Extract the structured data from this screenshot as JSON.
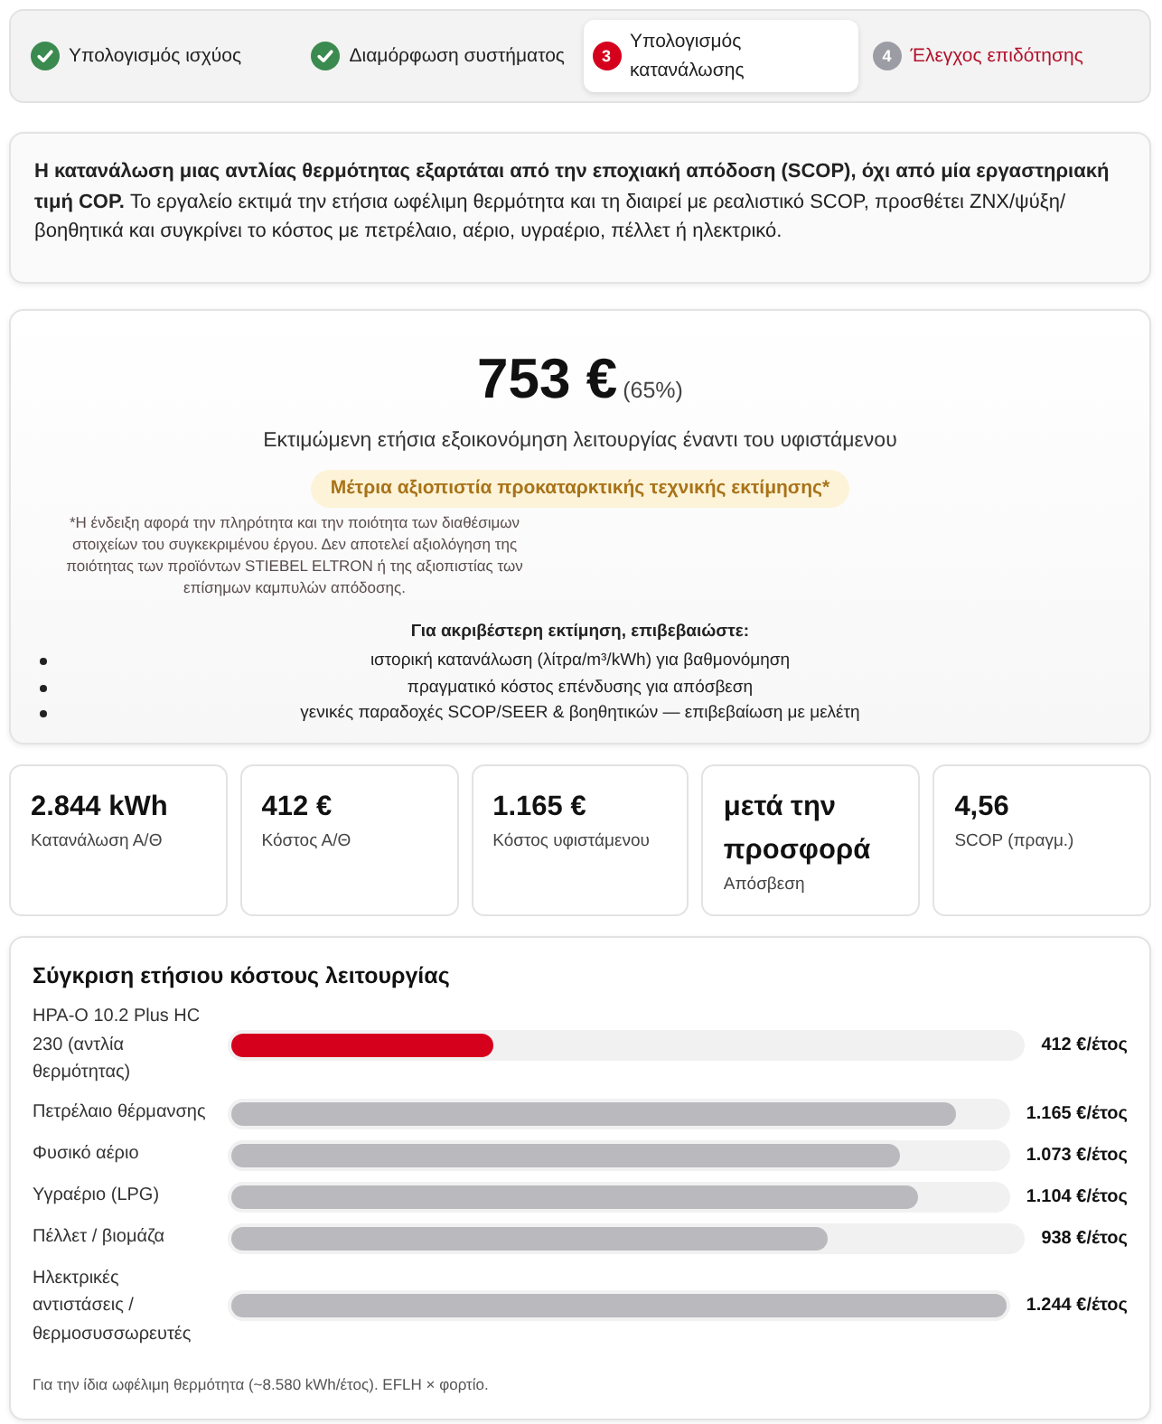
{
  "steps": [
    {
      "label": "Υπολογισμός ισχύος",
      "completed": true,
      "selected": false
    },
    {
      "label": "Διαμόρφωση συστήματος",
      "completed": true,
      "selected": false
    },
    {
      "label": "Υπολογισμός κατανάλωσης",
      "number": "3",
      "completed": false,
      "selected": true
    },
    {
      "label": "Έλεγχος επιδότησης",
      "number": "4",
      "completed": false,
      "selected": false
    }
  ],
  "intro": {
    "text": "**Η κατανάλωση μιας αντλίας θερμότητας εξαρτάται από την εποχιακή απόδοση (SCOP), όχι από μία εργαστηριακή τιμή COP.** Το εργαλείο εκτιμά την ετήσια ωφέλιμη θερμότητα και τη διαιρεί με ρεαλιστικό SCOP, προσθέτει ΖΝΧ/ψύξη/βοηθητικά και συγκρίνει το κόστος με πετρέλαιο, αέριο, υγραέριο, πέλλετ ή ηλεκτρικό."
  },
  "result": {
    "amount": "753 €",
    "percent": "(65%)",
    "caption": "Εκτιμώμενη ετήσια εξοικονόμηση λειτουργίας έναντι του υφιστάμενου",
    "confidence_badge": "Μέτρια αξιοπιστία προκαταρκτικής τεχνικής εκτίμησης*",
    "footnote": "*Η ένδειξη αφορά την πληρότητα και την ποιότητα των διαθέσιμων στοιχείων του συγκεκριμένου έργου. Δεν αποτελεί αξιολόγηση της ποιότητας των προϊόντων STIEBEL ELTRON ή της αξιοπιστίας των επίσημων καμπυλών απόδοσης.",
    "checklist_title": "Για ακριβέστερη εκτίμηση, επιβεβαιώστε:",
    "checklist": [
      "ιστορική κατανάλωση (λίτρα/m³/kWh) για βαθμονόμηση",
      "πραγματικό κόστος επένδυσης για απόσβεση",
      "γενικές παραδοχές SCOP/SEER & βοηθητικών — επιβεβαίωση με μελέτη"
    ]
  },
  "stats": [
    {
      "value": "2.844 kWh",
      "label": "Κατανάλωση Α/Θ"
    },
    {
      "value": "412 €",
      "label": "Κόστος Α/Θ"
    },
    {
      "value": "1.165 €",
      "label": "Κόστος υφιστάμενου"
    },
    {
      "value": "μετά την προσφορά",
      "label": "Απόσβεση"
    },
    {
      "value": "4,56",
      "label": "SCOP (πραγμ.)"
    }
  ],
  "comparison": {
    "title": "Σύγκριση ετήσιου κόστους λειτουργίας",
    "rows": [
      {
        "label": "HPA-O 10.2 Plus HC 230 (αντλία θερμότητας)",
        "value": "412 €/έτος",
        "level": 0.331,
        "color": "#d5001c"
      },
      {
        "label": "Πετρέλαιο θέρμανσης",
        "value": "1.165 €/έτος",
        "level": 0.936,
        "color": "#b9b9be"
      },
      {
        "label": "Φυσικό αέριο",
        "value": "1.073 €/έτος",
        "level": 0.863,
        "color": "#b9b9be"
      },
      {
        "label": "Υγραέριο (LPG)",
        "value": "1.104 €/έτος",
        "level": 0.887,
        "color": "#b9b9be"
      },
      {
        "label": "Πέλλετ / βιομάζα",
        "value": "938 €/έτος",
        "level": 0.754,
        "color": "#b9b9be"
      },
      {
        "label": "Ηλεκτρικές αντιστάσεις / θερμοσυσσωρευτές",
        "value": "1.244 €/έτος",
        "level": 1,
        "color": "#b9b9be"
      }
    ],
    "note": "Για την ίδια ωφέλιμη θερμότητα (~8.580 kWh/έτος). EFLH × φορτίο."
  }
}
